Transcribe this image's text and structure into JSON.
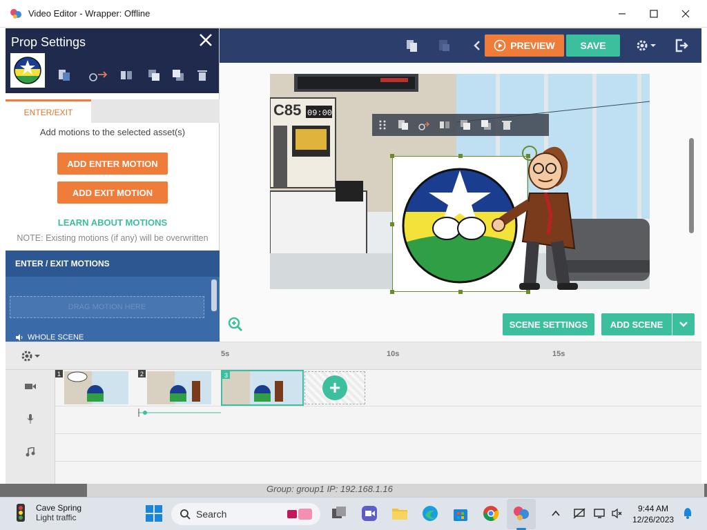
{
  "window": {
    "title": "Video Editor - Wrapper: Offline"
  },
  "header": {
    "preview_label": "PREVIEW",
    "save_label": "SAVE"
  },
  "prop_panel": {
    "title": "Prop Settings",
    "tab_enter_exit": "ENTER/EXIT",
    "description": "Add motions to the selected asset(s)",
    "add_enter_label": "ADD ENTER MOTION",
    "add_exit_label": "ADD EXIT MOTION",
    "learn_label": "LEARN ABOUT MOTIONS",
    "note": "NOTE: Existing motions (if any) will be overwritten",
    "motions_header": "ENTER / EXIT MOTIONS",
    "drag_hint": "DRAG MOTION HERE",
    "whole_scene_label": "WHOLE SCENE"
  },
  "scene": {
    "sign_text": "C85",
    "clock_text": "09:00"
  },
  "scene_controls": {
    "scene_settings_label": "SCENE SETTINGS",
    "add_scene_label": "ADD SCENE"
  },
  "timeline": {
    "ticks": [
      "5s",
      "10s",
      "15s"
    ],
    "scenes": [
      {
        "number": "1"
      },
      {
        "number": "2"
      },
      {
        "number": "3"
      }
    ]
  },
  "desktop": {
    "group_ip_text": "Group: group1   IP: 192.168.1.16"
  },
  "taskbar": {
    "weather_title": "Cave Spring",
    "weather_sub": "Light traffic",
    "search_label": "Search",
    "time": "9:44 AM",
    "date": "12/26/2023"
  },
  "colors": {
    "orange": "#f07c3a",
    "teal": "#3bbf9c",
    "navy": "#2c3e6b",
    "panel_navy": "#1f2a4d",
    "motion_blue": "#2d5791"
  }
}
